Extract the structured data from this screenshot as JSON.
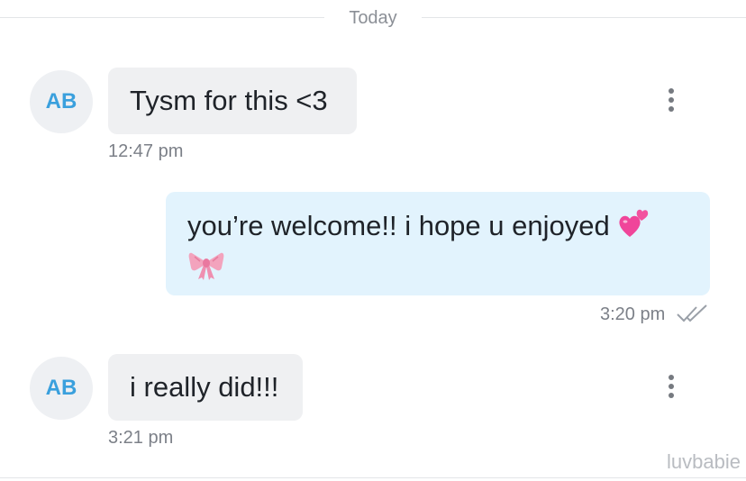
{
  "date_divider": "Today",
  "messages": [
    {
      "avatar_initials": "AB",
      "text": "Tysm for this <3",
      "time": "12:47 pm"
    },
    {
      "text": "you’re welcome!! i hope u enjoyed",
      "time": "3:20 pm",
      "emojis": [
        "two-hearts-icon",
        "ribbon-bow-icon"
      ],
      "status": "read-double-check-icon"
    },
    {
      "avatar_initials": "AB",
      "text": "i really did!!!",
      "time": "3:21 pm"
    }
  ],
  "watermark": "luvbabie",
  "colors": {
    "avatar_text": "#3aa0dd",
    "incoming_bubble": "#eff0f2",
    "outgoing_bubble": "#e2f3fd",
    "heart": "#f0459a"
  }
}
